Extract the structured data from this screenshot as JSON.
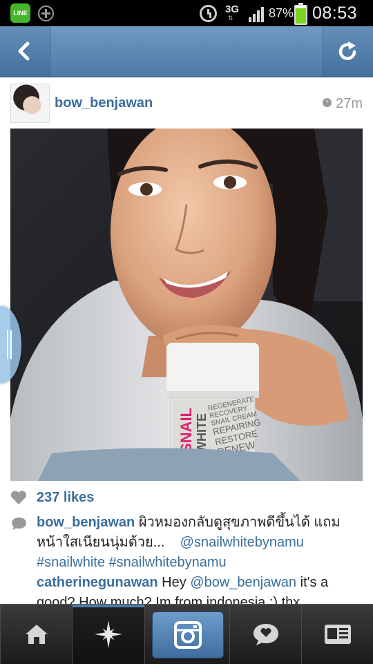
{
  "status_bar": {
    "line_label": "LINE",
    "network": "3G",
    "battery": "87%",
    "battery_level": 0.87,
    "time": "08:53",
    "icons": [
      "line-app-icon",
      "add-icon",
      "alarm-icon",
      "signal-icon",
      "battery-icon"
    ]
  },
  "header": {
    "back_icon": "chevron-left-icon",
    "refresh_icon": "refresh-icon",
    "accent": "#5a86b1"
  },
  "post": {
    "username": "bow_benjawan",
    "time_ago": "27m",
    "photo_product_text": "SNAIL WHITE",
    "photo_product_lines": [
      "REGENERATE",
      "RECOVERY",
      "SNAIL CREAM",
      "REPAIRING",
      "RESTORE",
      "RENEW"
    ],
    "likes": "237 likes"
  },
  "comments": [
    {
      "user": "bow_benjawan",
      "text": "ผิวหมองกลับดูสุขภาพดีขึ้นได้ แถมหน้าใสเนียนนุ่มด้วย...",
      "tag1": "@snailwhitebynamu",
      "tag2": "#snailwhite",
      "tag3": "#snailwhitebynamu"
    },
    {
      "user": "catherinegunawan",
      "text_before": "Hey",
      "mention": "@bow_benjawan",
      "text_after": "it's a good? How much? Im from indonesia :) thx"
    }
  ],
  "bottom_nav": {
    "items": [
      "home-icon",
      "explore-icon",
      "camera-icon",
      "news-icon",
      "profile-icon"
    ],
    "active": "explore-icon"
  },
  "colors": {
    "username_blue": "#3a6e9c",
    "nav_bar": "#2a2a2a",
    "camera_button": "#5a89b9"
  }
}
